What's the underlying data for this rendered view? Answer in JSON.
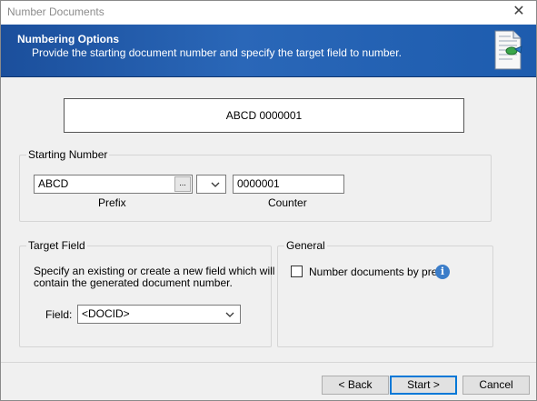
{
  "window": {
    "title": "Number Documents",
    "close_glyph": "✕"
  },
  "banner": {
    "title": "Numbering Options",
    "subtitle": "Provide the starting document number and specify the target field to number.",
    "icon": "document-numbering-icon"
  },
  "preview": {
    "value": "ABCD 0000001"
  },
  "starting_number": {
    "label": "Starting Number",
    "prefix_value": "ABCD",
    "browse_label": "...",
    "separator_value": "",
    "counter_value": "0000001",
    "prefix_caption": "Prefix",
    "counter_caption": "Counter"
  },
  "target_field": {
    "label": "Target Field",
    "description_line1": "Specify an existing or create a new field which will",
    "description_line2": "contain the generated document number.",
    "field_label": "Field:",
    "field_value": "<DOCID>"
  },
  "general": {
    "label": "General",
    "number_by_prefix_label": "Number documents by prefix",
    "number_by_prefix_checked": false,
    "info_glyph": "i"
  },
  "buttons": {
    "back": "< Back",
    "start": "Start >",
    "cancel": "Cancel"
  },
  "colors": {
    "banner": "#1b4f9c",
    "accent": "#0078d7",
    "info": "#3b7dc9"
  }
}
